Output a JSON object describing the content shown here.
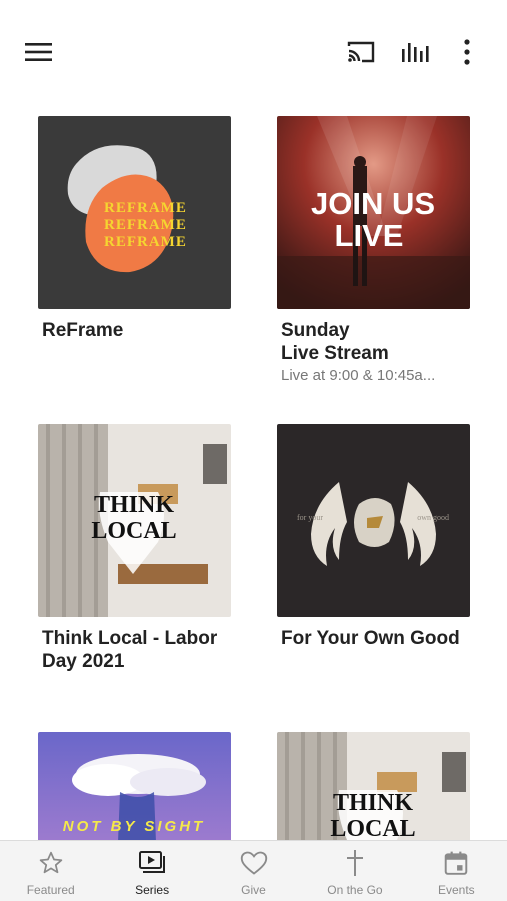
{
  "header": {
    "menu_icon": "hamburger-menu-icon",
    "cast_icon": "cast-icon",
    "audio_icon": "audio-bars-icon",
    "more_icon": "more-vertical-icon"
  },
  "series": [
    {
      "title": "ReFrame",
      "subtitle": "",
      "art_text": "REFRAME"
    },
    {
      "title": "Sunday\nLive Stream",
      "subtitle": "Live at 9:00 & 10:45a...",
      "art_text_1": "JOIN US",
      "art_text_2": "LIVE"
    },
    {
      "title": "Think Local - Labor Day 2021",
      "subtitle": "",
      "art_text_1": "THINK",
      "art_text_2": "LOCAL"
    },
    {
      "title": "For Your Own Good",
      "subtitle": "",
      "art_text_1": "for your",
      "art_text_2": "own good"
    },
    {
      "title": "",
      "subtitle": "",
      "art_text": "NOT BY SIGHT"
    },
    {
      "title": "",
      "subtitle": "",
      "art_text_1": "THINK",
      "art_text_2": "LOCAL"
    }
  ],
  "tabs": [
    {
      "label": "Featured",
      "icon": "star-icon",
      "active": false
    },
    {
      "label": "Series",
      "icon": "play-stack-icon",
      "active": true
    },
    {
      "label": "Give",
      "icon": "heart-icon",
      "active": false
    },
    {
      "label": "On the Go",
      "icon": "cross-icon",
      "active": false
    },
    {
      "label": "Events",
      "icon": "calendar-icon",
      "active": false
    }
  ],
  "colors": {
    "reframe_bg": "#3a3a3a",
    "reframe_orange": "#f07a45",
    "reframe_yellow": "#f5d530",
    "live_red": "#b23a2c",
    "dark_card": "#2b2728",
    "sky_purple": "#7a6fc8",
    "tab_bg": "#f4f4f4"
  }
}
